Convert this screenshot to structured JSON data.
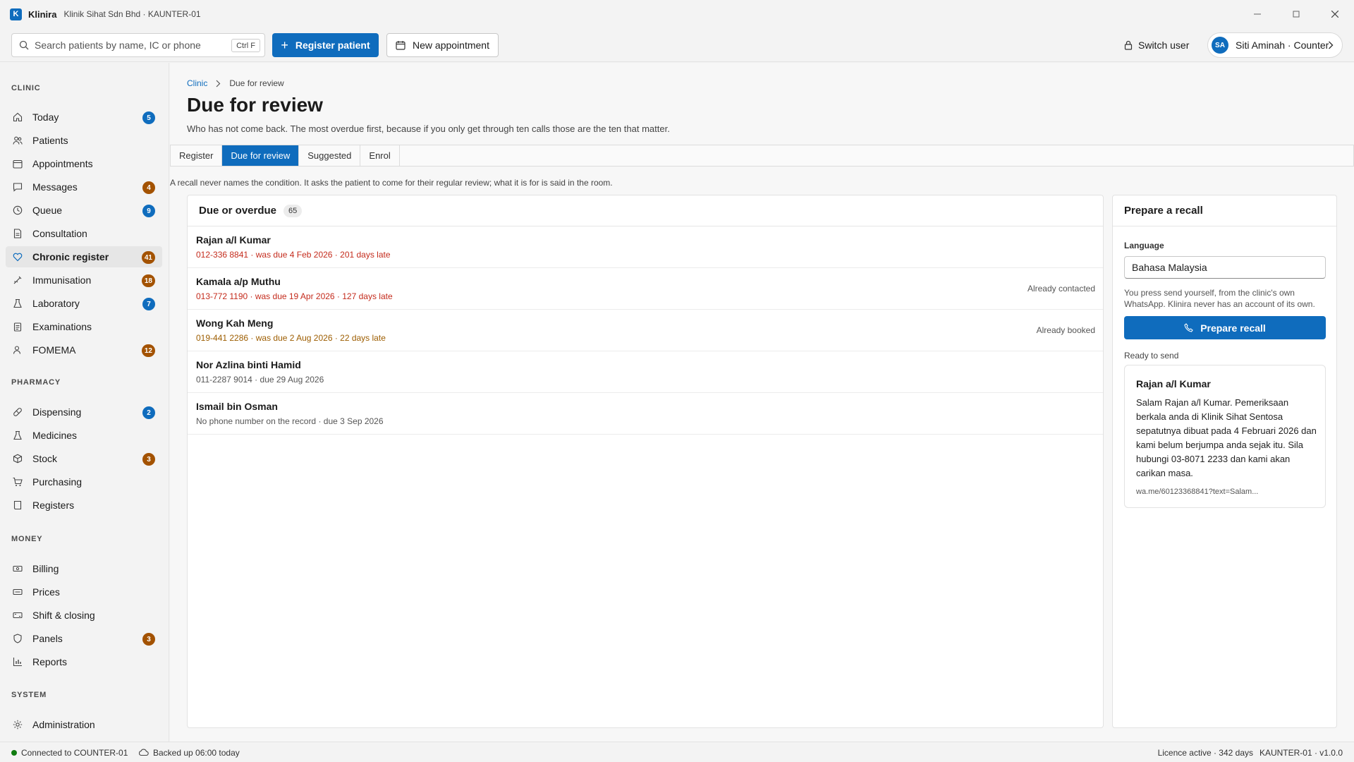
{
  "window": {
    "app_logo": "K",
    "app_name": "Klinira",
    "subtitle": "Klinik Sihat Sdn Bhd · KAUNTER-01"
  },
  "toolbar": {
    "search_placeholder": "Search patients by name, IC or phone",
    "search_shortcut": "Ctrl F",
    "register_label": "Register patient",
    "appointment_label": "New appointment",
    "switch_user_label": "Switch user",
    "user_initials": "SA",
    "user_name": "Siti Aminah · Counter"
  },
  "sidebar": {
    "sections": [
      {
        "title": "CLINIC",
        "items": [
          {
            "label": "Today",
            "icon": "home-icon",
            "badge": "5",
            "badge_color": "blue"
          },
          {
            "label": "Patients",
            "icon": "people-icon"
          },
          {
            "label": "Appointments",
            "icon": "calendar-icon"
          },
          {
            "label": "Messages",
            "icon": "message-icon",
            "badge": "4",
            "badge_color": "amber"
          },
          {
            "label": "Queue",
            "icon": "clock-icon",
            "badge": "9",
            "badge_color": "blue"
          },
          {
            "label": "Consultation",
            "icon": "document-icon"
          },
          {
            "label": "Chronic register",
            "icon": "heart-icon",
            "badge": "41",
            "badge_color": "amber",
            "active": true
          },
          {
            "label": "Immunisation",
            "icon": "syringe-icon",
            "badge": "18",
            "badge_color": "amber"
          },
          {
            "label": "Laboratory",
            "icon": "flask-icon",
            "badge": "7",
            "badge_color": "blue"
          },
          {
            "label": "Examinations",
            "icon": "clipboard-icon"
          },
          {
            "label": "FOMEMA",
            "icon": "person-icon",
            "badge": "12",
            "badge_color": "amber"
          }
        ]
      },
      {
        "title": "PHARMACY",
        "items": [
          {
            "label": "Dispensing",
            "icon": "pill-icon",
            "badge": "2",
            "badge_color": "blue"
          },
          {
            "label": "Medicines",
            "icon": "flask-icon"
          },
          {
            "label": "Stock",
            "icon": "box-icon",
            "badge": "3",
            "badge_color": "amber"
          },
          {
            "label": "Purchasing",
            "icon": "cart-icon"
          },
          {
            "label": "Registers",
            "icon": "book-icon"
          }
        ]
      },
      {
        "title": "MONEY",
        "items": [
          {
            "label": "Billing",
            "icon": "money-icon"
          },
          {
            "label": "Prices",
            "icon": "tag-icon"
          },
          {
            "label": "Shift & closing",
            "icon": "cash-icon"
          },
          {
            "label": "Panels",
            "icon": "shield-icon",
            "badge": "3",
            "badge_color": "amber"
          },
          {
            "label": "Reports",
            "icon": "chart-icon"
          }
        ]
      },
      {
        "title": "SYSTEM",
        "items": [
          {
            "label": "Administration",
            "icon": "gear-icon"
          }
        ]
      }
    ]
  },
  "main": {
    "breadcrumb": {
      "root": "Clinic",
      "current": "Due for review"
    },
    "title": "Due for review",
    "subtitle": "Who has not come back. The most overdue first, because if you only get through ten calls those are the ten that matter.",
    "tabs": [
      {
        "label": "Register"
      },
      {
        "label": "Due for review",
        "active": true
      },
      {
        "label": "Suggested"
      },
      {
        "label": "Enrol"
      }
    ],
    "notice": "A recall never names the condition. It asks the patient to come for their regular review; what it is for is said in the room.",
    "list": {
      "title": "Due or overdue",
      "count": "65",
      "rows": [
        {
          "name": "Rajan a/l Kumar",
          "meta": "012-336 8841 · was due 4 Feb 2026 · 201 days late",
          "tone": "red",
          "status": ""
        },
        {
          "name": "Kamala a/p Muthu",
          "meta": "013-772 1190 · was due 19 Apr 2026 · 127 days late",
          "tone": "red",
          "status": "Already contacted"
        },
        {
          "name": "Wong Kah Meng",
          "meta": "019-441 2286 · was due 2 Aug 2026 · 22 days late",
          "tone": "amber",
          "status": "Already booked"
        },
        {
          "name": "Nor Azlina binti Hamid",
          "meta": "011-2287 9014 · due 29 Aug 2026",
          "tone": "grey",
          "status": ""
        },
        {
          "name": "Ismail bin Osman",
          "meta": "No phone number on the record · due 3 Sep 2026",
          "tone": "grey",
          "status": ""
        }
      ]
    },
    "recall": {
      "title": "Prepare a recall",
      "language_label": "Language",
      "language_value": "Bahasa Malaysia",
      "help": "You press send yourself, from the clinic's own WhatsApp. Klinira never has an account of its own.",
      "button_label": "Prepare recall",
      "ready_label": "Ready to send",
      "preview_name": "Rajan a/l Kumar",
      "preview_text": "Salam Rajan a/l Kumar. Pemeriksaan berkala anda di Klinik Sihat Sentosa sepatutnya dibuat pada 4 Februari 2026 dan kami belum berjumpa anda sejak itu. Sila hubungi 03-8071 2233 dan kami akan carikan masa.",
      "preview_link": "wa.me/60123368841?text=Salam..."
    }
  },
  "statusbar": {
    "connection": "Connected to COUNTER-01",
    "backup": "Backed up 06:00 today",
    "licence": "Licence active · 342 days",
    "version": "KAUNTER-01 · v1.0.0"
  },
  "colors": {
    "accent": "#0f6cbd",
    "overdue": "#c42b1c",
    "warning": "#9d5d00",
    "badge_amber": "#a35200",
    "online": "#107c10"
  }
}
